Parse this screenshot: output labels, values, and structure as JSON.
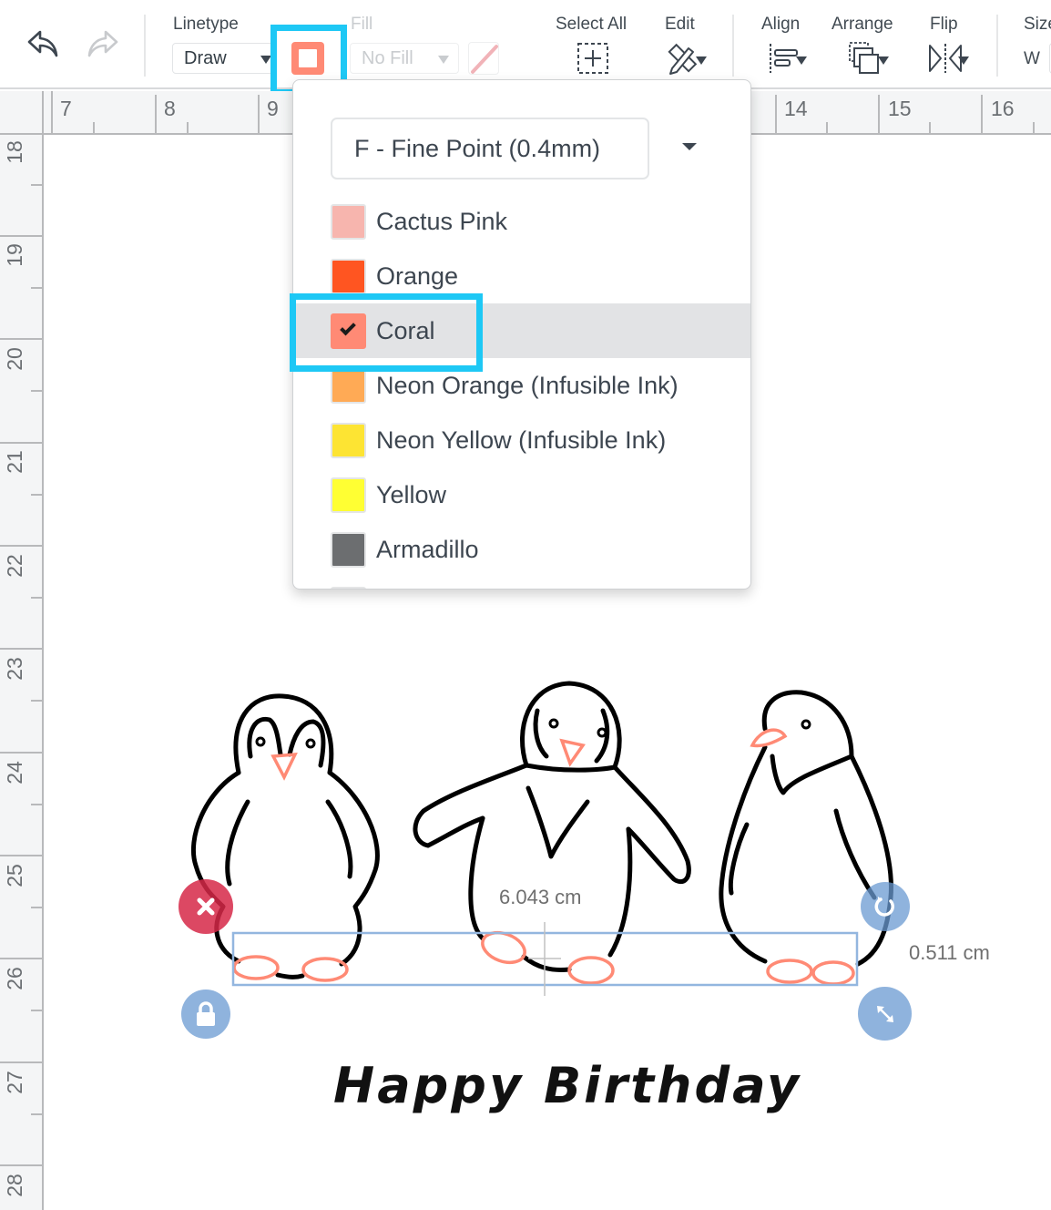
{
  "toolbar": {
    "undo_icon": "undo-arrow-icon",
    "redo_icon": "redo-arrow-icon",
    "linetype": {
      "label": "Linetype",
      "value": "Draw"
    },
    "stroke_color": "#ff8a75",
    "fill": {
      "label": "Fill",
      "value": "No Fill",
      "enabled": false
    },
    "select_all": {
      "label": "Select All",
      "icon": "dashed-plus-icon"
    },
    "edit": {
      "label": "Edit",
      "icon": "pencil-ruler-icon"
    },
    "align": {
      "label": "Align",
      "icon": "align-left-icon"
    },
    "arrange": {
      "label": "Arrange",
      "icon": "layers-icon"
    },
    "flip": {
      "label": "Flip",
      "icon": "flip-horizontal-icon"
    },
    "size": {
      "label": "Size",
      "w_label": "W"
    }
  },
  "ruler": {
    "horizontal": [
      "7",
      "8",
      "9",
      "14",
      "15",
      "16"
    ],
    "vertical": [
      "18",
      "19",
      "20",
      "21",
      "22",
      "23",
      "24",
      "25",
      "26",
      "27",
      "28"
    ]
  },
  "pen_dropdown": {
    "pen_type": "F - Fine Point (0.4mm)",
    "selected_color": "Coral",
    "colors": [
      {
        "name": "Cactus Pink",
        "hex": "#f7b5ae",
        "selected": false
      },
      {
        "name": "Orange",
        "hex": "#ff5521",
        "selected": false
      },
      {
        "name": "Coral",
        "hex": "#ff8a75",
        "selected": true
      },
      {
        "name": "Neon Orange (Infusible Ink)",
        "hex": "#ffaa55",
        "selected": false
      },
      {
        "name": "Neon Yellow (Infusible Ink)",
        "hex": "#fde433",
        "selected": false
      },
      {
        "name": "Yellow",
        "hex": "#ffff33",
        "selected": false
      },
      {
        "name": "Armadillo",
        "hex": "#6c6e70",
        "selected": false
      }
    ],
    "partial_next_color_hex": "#8a6a70"
  },
  "selection": {
    "width_label": "6.043 cm",
    "height_label": "0.511 cm"
  },
  "canvas": {
    "text": "Happy Birthday",
    "line_color": "#000000",
    "accent_color": "#ff8a75"
  },
  "highlight_color": "#1ec8f5"
}
